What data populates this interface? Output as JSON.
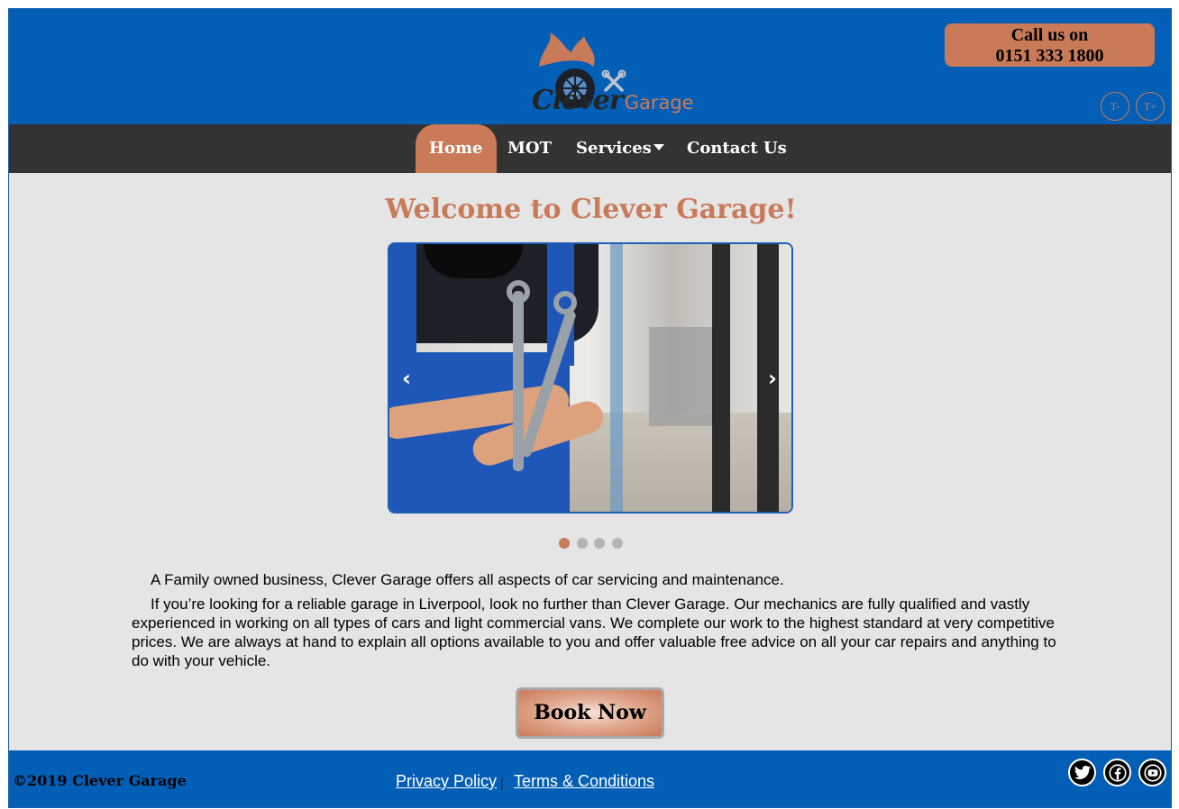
{
  "header": {
    "logo": {
      "brand_main": "Clever",
      "brand_sub": "Garage"
    },
    "call": {
      "line1": "Call us on",
      "line2": "0151 333 1800"
    },
    "font_controls": {
      "decrease_label": "T-",
      "increase_label": "T+"
    }
  },
  "nav": {
    "items": [
      {
        "label": "Home",
        "active": true
      },
      {
        "label": "MOT",
        "active": false
      },
      {
        "label": "Services",
        "active": false,
        "has_dropdown": true
      },
      {
        "label": "Contact Us",
        "active": false
      }
    ]
  },
  "main": {
    "title": "Welcome to Clever Garage!",
    "slider": {
      "prev_arrow": "‹",
      "next_arrow": "›",
      "slide_count": 4,
      "active_slide": 1
    },
    "paragraphs": [
      "A Family owned business, Clever Garage offers all aspects of car servicing and maintenance.",
      "If you’re looking for a reliable garage in Liverpool, look no further than Clever Garage. Our mechanics are fully qualified and vastly experienced in working on all types of cars and light commercial vans. We complete our work to the highest standard at very competitive prices. We are always at hand to explain all options available to you and offer valuable free advice on all your car repairs and anything to do with your vehicle."
    ],
    "book_button": "Book Now"
  },
  "footer": {
    "copyright": "©2019 Clever Garage",
    "links": {
      "privacy": "Privacy Policy",
      "separator": "|",
      "terms": "Terms & Conditions"
    },
    "social": [
      "twitter-icon",
      "facebook-icon",
      "youtube-icon"
    ]
  },
  "colors": {
    "brand_blue": "#035fb6",
    "accent_copper": "#c97a58",
    "nav_dark": "#333333",
    "page_bg": "#e5e5e5"
  }
}
